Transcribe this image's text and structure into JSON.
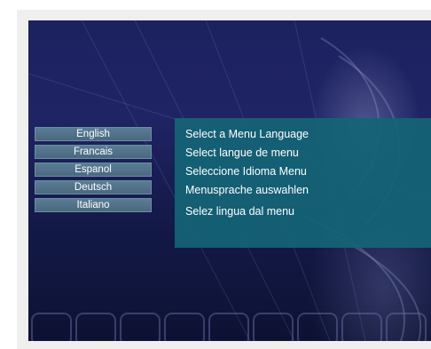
{
  "languages": [
    {
      "label": "English"
    },
    {
      "label": "Francais"
    },
    {
      "label": "Espanol"
    },
    {
      "label": "Deutsch"
    },
    {
      "label": "Italiano"
    }
  ],
  "prompts": [
    "Select a Menu Language",
    "Select langue de menu",
    "Seleccione Idioma Menu",
    "Menusprache auswahlen",
    "Selez lingua dal menu"
  ],
  "colors": {
    "button": "#4f7187",
    "panel": "#146476",
    "background": "#1c2160"
  }
}
